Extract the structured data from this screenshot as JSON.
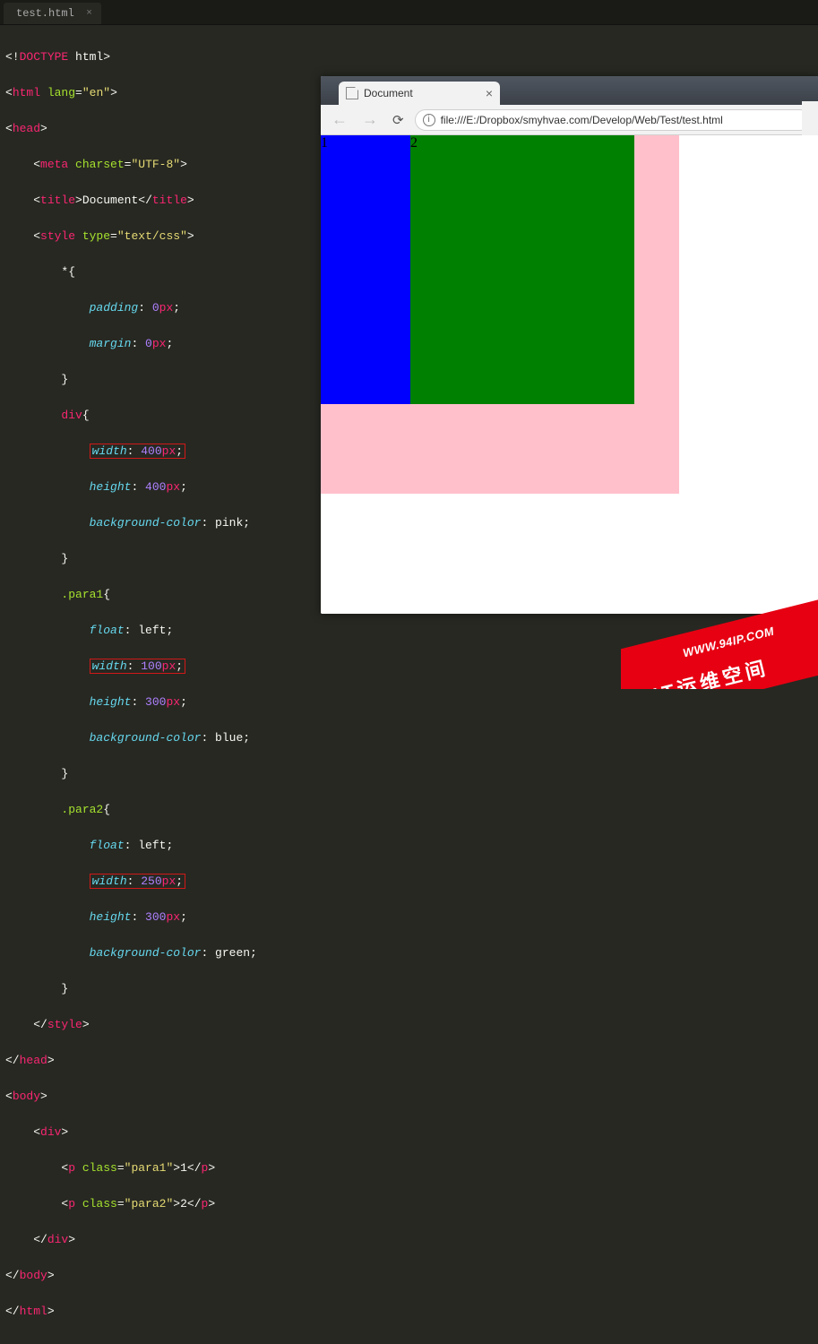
{
  "editor": {
    "tab_name": "test.html",
    "highlighted_props": {
      "div_width": "width: 400px;",
      "para1_width": "width: 100px;",
      "para2_width": "width: 250px;"
    },
    "code": {
      "l1": {
        "a": "<!",
        "b": "DOCTYPE",
        "c": " html",
        "d": ">"
      },
      "l2": {
        "a": "<",
        "b": "html",
        "c": " lang",
        "d": "=",
        "e": "\"en\"",
        "f": ">"
      },
      "l3": {
        "a": "<",
        "b": "head",
        "c": ">"
      },
      "l4": {
        "a": "    <",
        "b": "meta",
        "c": " charset",
        "d": "=",
        "e": "\"UTF-8\"",
        "f": ">"
      },
      "l5": {
        "a": "    <",
        "b": "title",
        "c": ">",
        "d": "Document",
        "e": "</",
        "f": "title",
        "g": ">"
      },
      "l6": {
        "a": "    <",
        "b": "style",
        "c": " type",
        "d": "=",
        "e": "\"text/css\"",
        "f": ">"
      },
      "l7": "        *{",
      "l8": {
        "a": "            ",
        "b": "padding",
        "c": ": ",
        "d": "0",
        "e": "px",
        "f": ";"
      },
      "l9": {
        "a": "            ",
        "b": "margin",
        "c": ": ",
        "d": "0",
        "e": "px",
        "f": ";"
      },
      "l10": "        }",
      "l11": {
        "a": "        ",
        "b": "div",
        "c": "{"
      },
      "l12": {
        "a": "            ",
        "hl": "width: 400px;"
      },
      "l12p": {
        "b": "width",
        "c": ": ",
        "d": "400",
        "e": "px",
        "f": ";"
      },
      "l13": {
        "a": "            ",
        "b": "height",
        "c": ": ",
        "d": "400",
        "e": "px",
        "f": ";"
      },
      "l14": {
        "a": "            ",
        "b": "background-color",
        "c": ": pink;"
      },
      "l15": "        }",
      "l16": {
        "a": "        ",
        "b": ".para1",
        "c": "{"
      },
      "l17": {
        "a": "            ",
        "b": "float",
        "c": ": left;"
      },
      "l18p": {
        "b": "width",
        "c": ": ",
        "d": "100",
        "e": "px",
        "f": ";"
      },
      "l19": {
        "a": "            ",
        "b": "height",
        "c": ": ",
        "d": "300",
        "e": "px",
        "f": ";"
      },
      "l20": {
        "a": "            ",
        "b": "background-color",
        "c": ": blue;"
      },
      "l21": "        }",
      "l22": {
        "a": "        ",
        "b": ".para2",
        "c": "{"
      },
      "l23": {
        "a": "            ",
        "b": "float",
        "c": ": left;"
      },
      "l24p": {
        "b": "width",
        "c": ": ",
        "d": "250",
        "e": "px",
        "f": ";"
      },
      "l25": {
        "a": "            ",
        "b": "height",
        "c": ": ",
        "d": "300",
        "e": "px",
        "f": ";"
      },
      "l26": {
        "a": "            ",
        "b": "background-color",
        "c": ": green;"
      },
      "l27": "        }",
      "l28": {
        "a": "    </",
        "b": "style",
        "c": ">"
      },
      "l29": {
        "a": "</",
        "b": "head",
        "c": ">"
      },
      "l30": {
        "a": "<",
        "b": "body",
        "c": ">"
      },
      "l31": {
        "a": "    <",
        "b": "div",
        "c": ">"
      },
      "l32": {
        "a": "        <",
        "b": "p",
        "c": " class",
        "d": "=",
        "e": "\"para1\"",
        "f": ">",
        "g": "1",
        "h": "</",
        "i": "p",
        "j": ">"
      },
      "l33": {
        "a": "        <",
        "b": "p",
        "c": " class",
        "d": "=",
        "e": "\"para2\"",
        "f": ">",
        "g": "2",
        "h": "</",
        "i": "p",
        "j": ">"
      },
      "l34": {
        "a": "    </",
        "b": "div",
        "c": ">"
      },
      "l35": {
        "a": "</",
        "b": "body",
        "c": ">"
      },
      "l36": {
        "a": "</",
        "b": "html",
        "c": ">"
      }
    }
  },
  "browser": {
    "tab_title": "Document",
    "url": "file:///E:/Dropbox/smyhvae.com/Develop/Web/Test/test.html",
    "content": {
      "p1": "1",
      "p2": "2"
    }
  },
  "watermark": {
    "url": "WWW.94IP.COM",
    "text": "IT运维空间"
  }
}
